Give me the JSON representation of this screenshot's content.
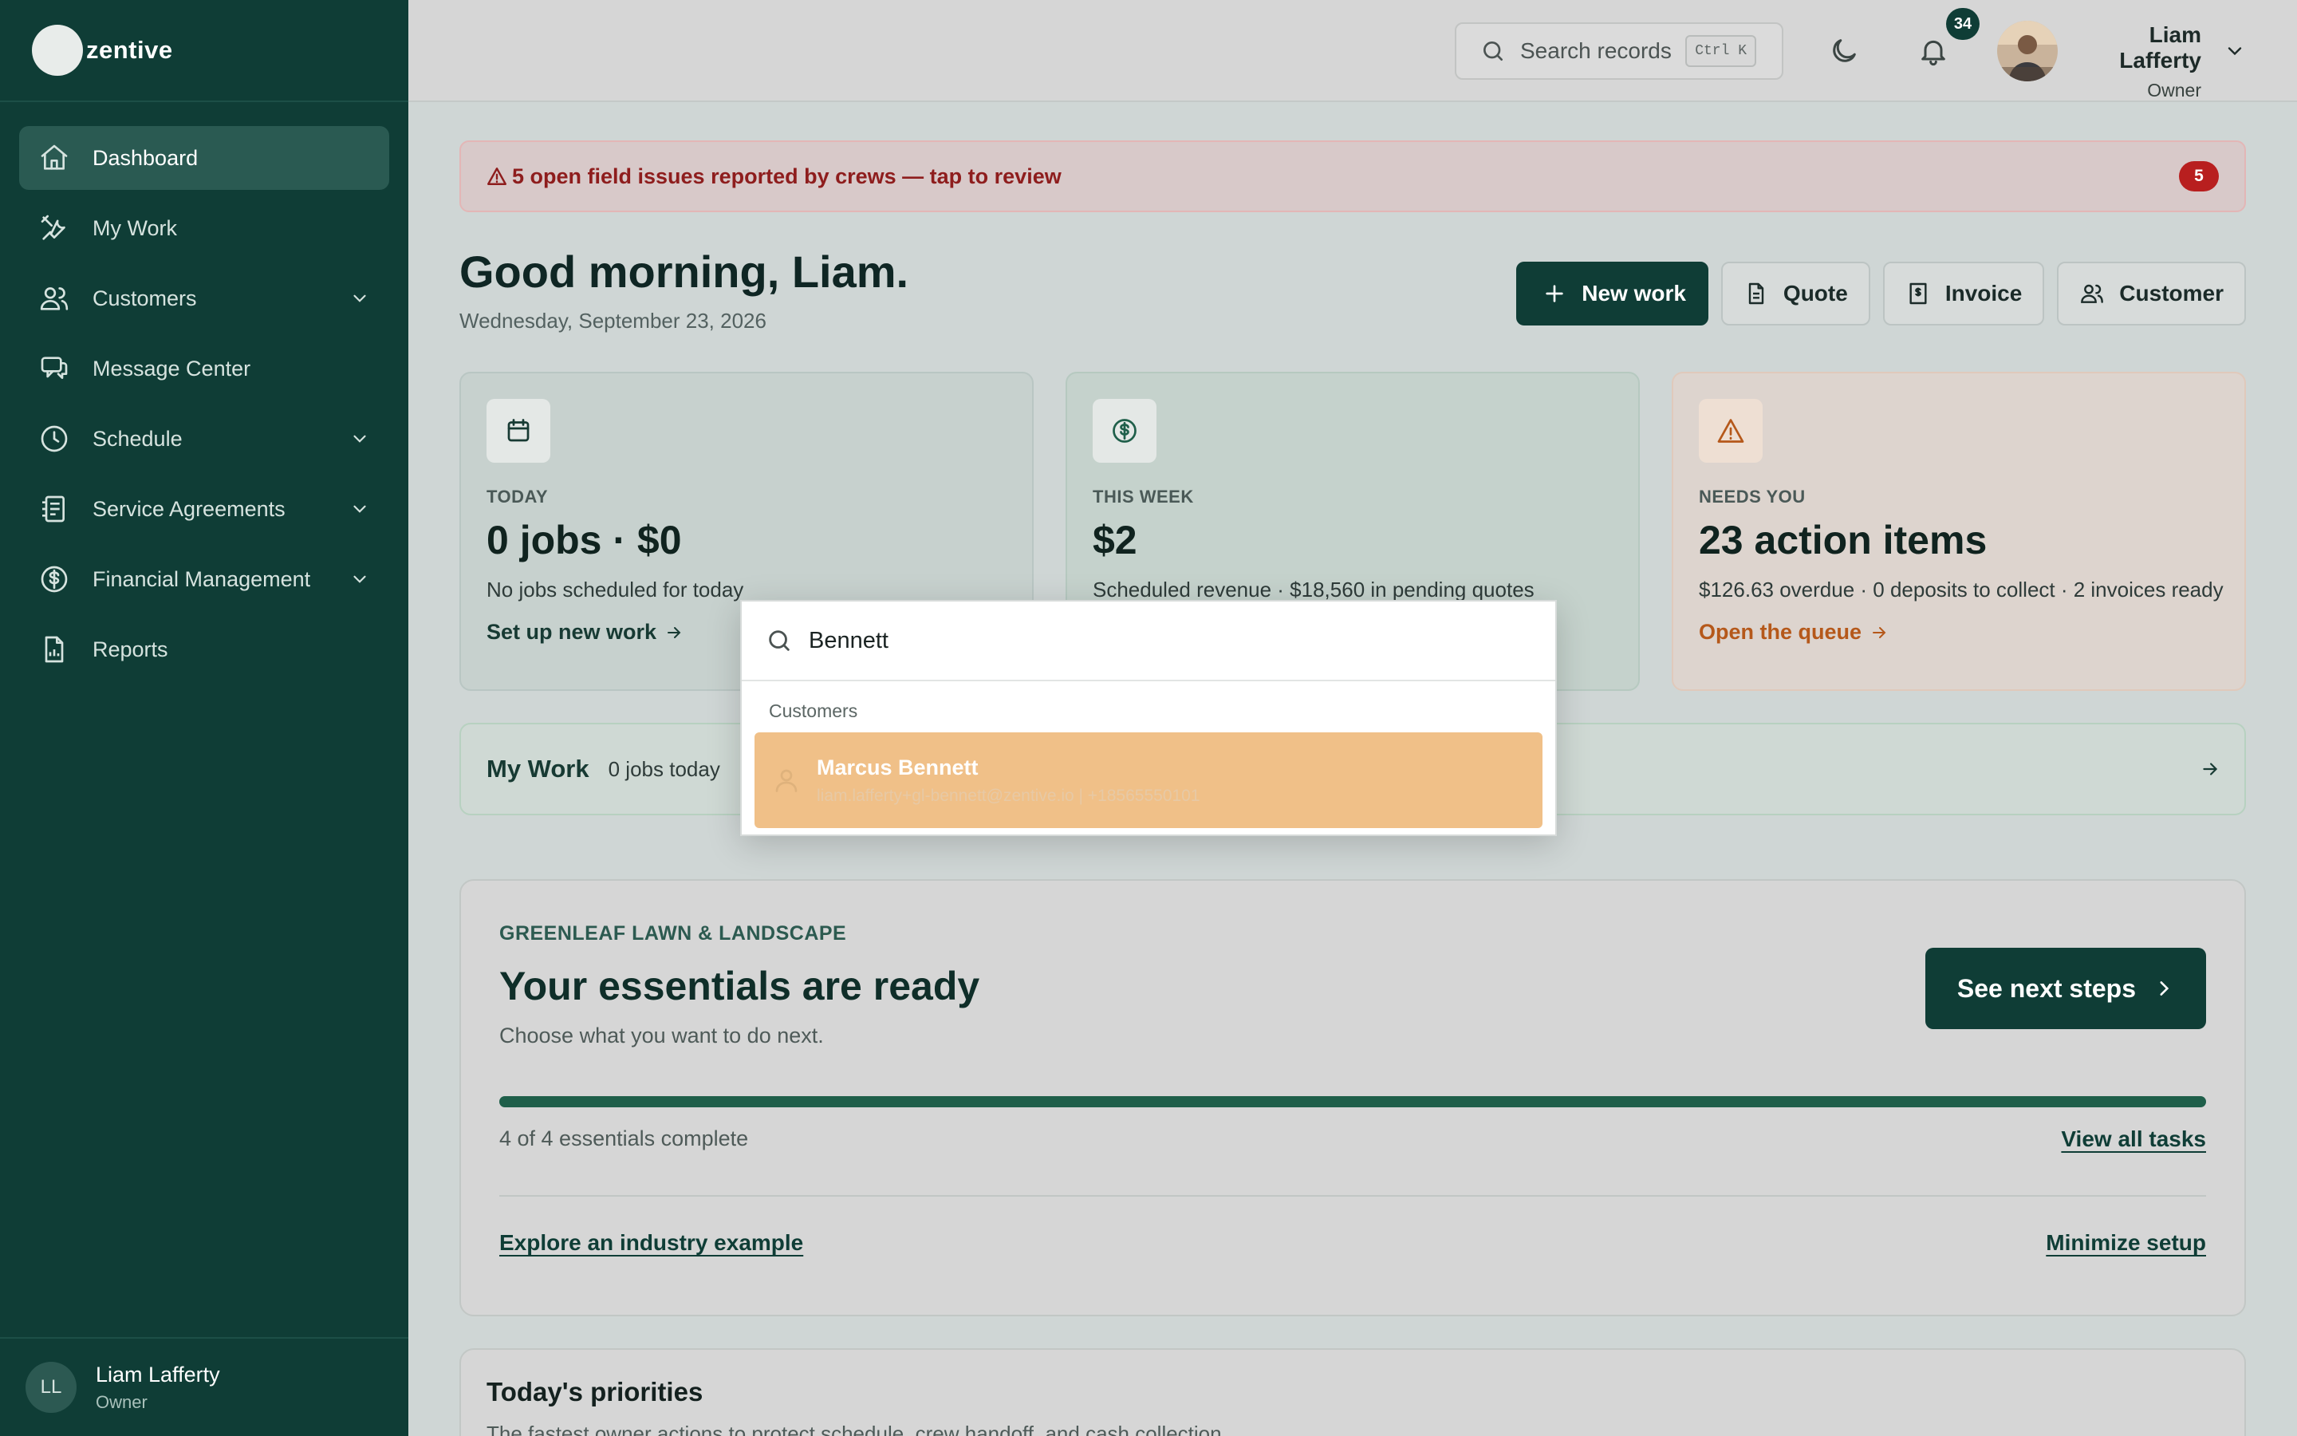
{
  "brand": {
    "name": "zentive"
  },
  "sidebar": {
    "items": [
      {
        "label": "Dashboard",
        "icon": "home-icon",
        "active": true,
        "has_chevron": false
      },
      {
        "label": "My Work",
        "icon": "tools-icon",
        "active": false,
        "has_chevron": false
      },
      {
        "label": "Customers",
        "icon": "users-icon",
        "active": false,
        "has_chevron": true
      },
      {
        "label": "Message Center",
        "icon": "message-icon",
        "active": false,
        "has_chevron": false
      },
      {
        "label": "Schedule",
        "icon": "clock-icon",
        "active": false,
        "has_chevron": true
      },
      {
        "label": "Service Agreements",
        "icon": "agreement-icon",
        "active": false,
        "has_chevron": true
      },
      {
        "label": "Financial Management",
        "icon": "dollar-icon",
        "active": false,
        "has_chevron": true
      },
      {
        "label": "Reports",
        "icon": "report-icon",
        "active": false,
        "has_chevron": false
      }
    ],
    "user": {
      "initials": "LL",
      "name": "Liam Lafferty",
      "role": "Owner"
    }
  },
  "topbar": {
    "search_placeholder": "Search records",
    "shortcut": "Ctrl K",
    "notification_count": "34",
    "user_name": "Liam Lafferty",
    "user_role": "Owner"
  },
  "alert": {
    "text": "5 open field issues reported by crews — tap to review",
    "count": "5"
  },
  "greeting": {
    "title": "Good morning, Liam.",
    "date": "Wednesday, September 23, 2026"
  },
  "quick_actions": {
    "new_work": "New work",
    "quote": "Quote",
    "invoice": "Invoice",
    "customer": "Customer"
  },
  "cards": {
    "today": {
      "label": "TODAY",
      "value": "0 jobs · $0",
      "sub": "No jobs scheduled for today",
      "link": "Set up new work"
    },
    "week": {
      "label": "THIS WEEK",
      "value": "$2",
      "sub": "Scheduled revenue · $18,560 in pending quotes"
    },
    "needs": {
      "label": "NEEDS YOU",
      "value": "23 action items",
      "sub": "$126.63 overdue · 0 deposits to collect · 2 invoices ready",
      "link": "Open the queue"
    }
  },
  "my_work": {
    "title": "My Work",
    "sub": "0 jobs today"
  },
  "setup": {
    "eyebrow": "GREENLEAF LAWN & LANDSCAPE",
    "title": "Your essentials are ready",
    "sub": "Choose what you want to do next.",
    "button": "See next steps",
    "progress": 1.0,
    "count_text": "4 of 4 essentials complete",
    "view_all": "View all tasks",
    "explore": "Explore an industry example",
    "minimize": "Minimize setup"
  },
  "priorities": {
    "title": "Today's priorities",
    "sub": "The fastest owner actions to protect schedule, crew handoff, and cash collection."
  },
  "search_popup": {
    "query": "Bennett",
    "group": "Customers",
    "result": {
      "name": "Marcus Bennett",
      "detail": "liam.lafferty+gl-bennett@zentive.io | +18565550101"
    }
  },
  "colors": {
    "sidebar_bg": "#0f3d36",
    "accent": "#0f3d36",
    "alert_red": "#b81f1f",
    "highlight": "#f0c088",
    "needs_orange": "#b5581a"
  }
}
